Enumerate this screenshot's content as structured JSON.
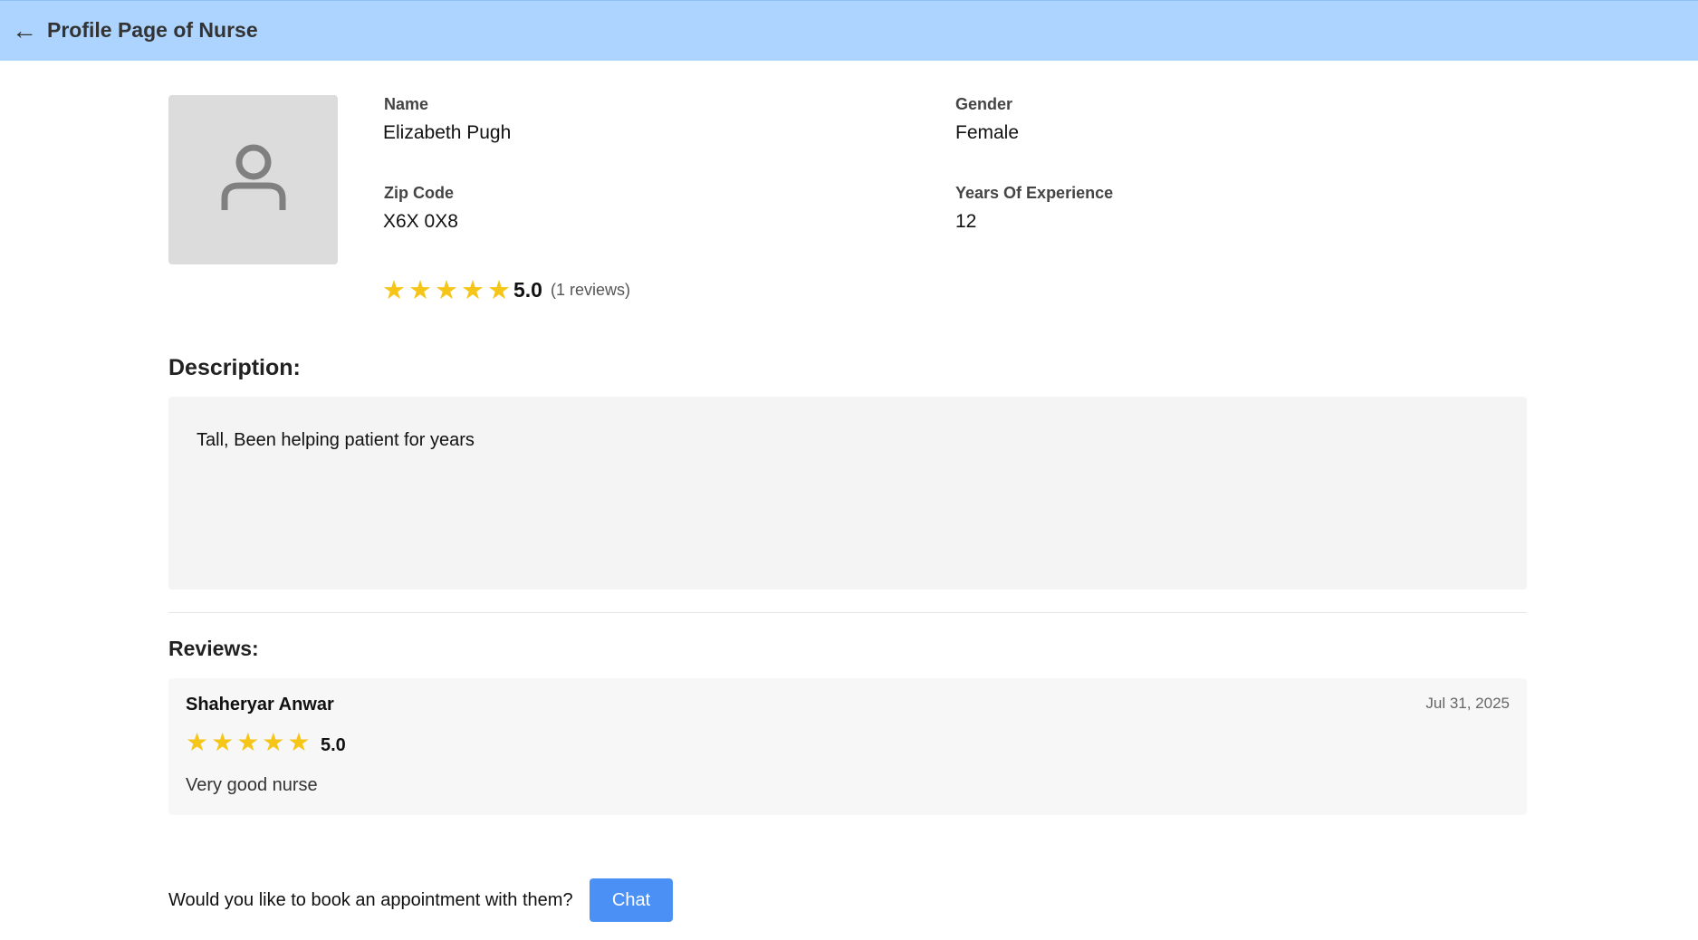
{
  "header": {
    "back_icon": "←",
    "title": "Profile Page of Nurse"
  },
  "profile": {
    "avatar_icon": "user-icon",
    "name_label": "Name",
    "name": "Elizabeth Pugh",
    "gender_label": "Gender",
    "gender": "Female",
    "zip_label": "Zip Code",
    "zip": "X6X 0X8",
    "experience_label": "Years Of Experience",
    "experience": "12",
    "stars": "★★★★★",
    "rating": "5.0",
    "reviews_count": "(1 reviews)"
  },
  "description": {
    "title": "Description:",
    "text": "Tall, Been helping patient for years"
  },
  "reviews": {
    "title": "Reviews:",
    "items": [
      {
        "reviewer": "Shaheryar Anwar",
        "date": "Jul 31, 2025",
        "stars": "★★★★★",
        "rating": "5.0",
        "text": "Very good nurse"
      }
    ]
  },
  "booking": {
    "prompt": "Would you like to book an appointment with them?",
    "chat_label": "Chat"
  },
  "colors": {
    "header_bg": "#acd4fe",
    "star": "#f5c518",
    "chat_button": "#4a90f5"
  }
}
